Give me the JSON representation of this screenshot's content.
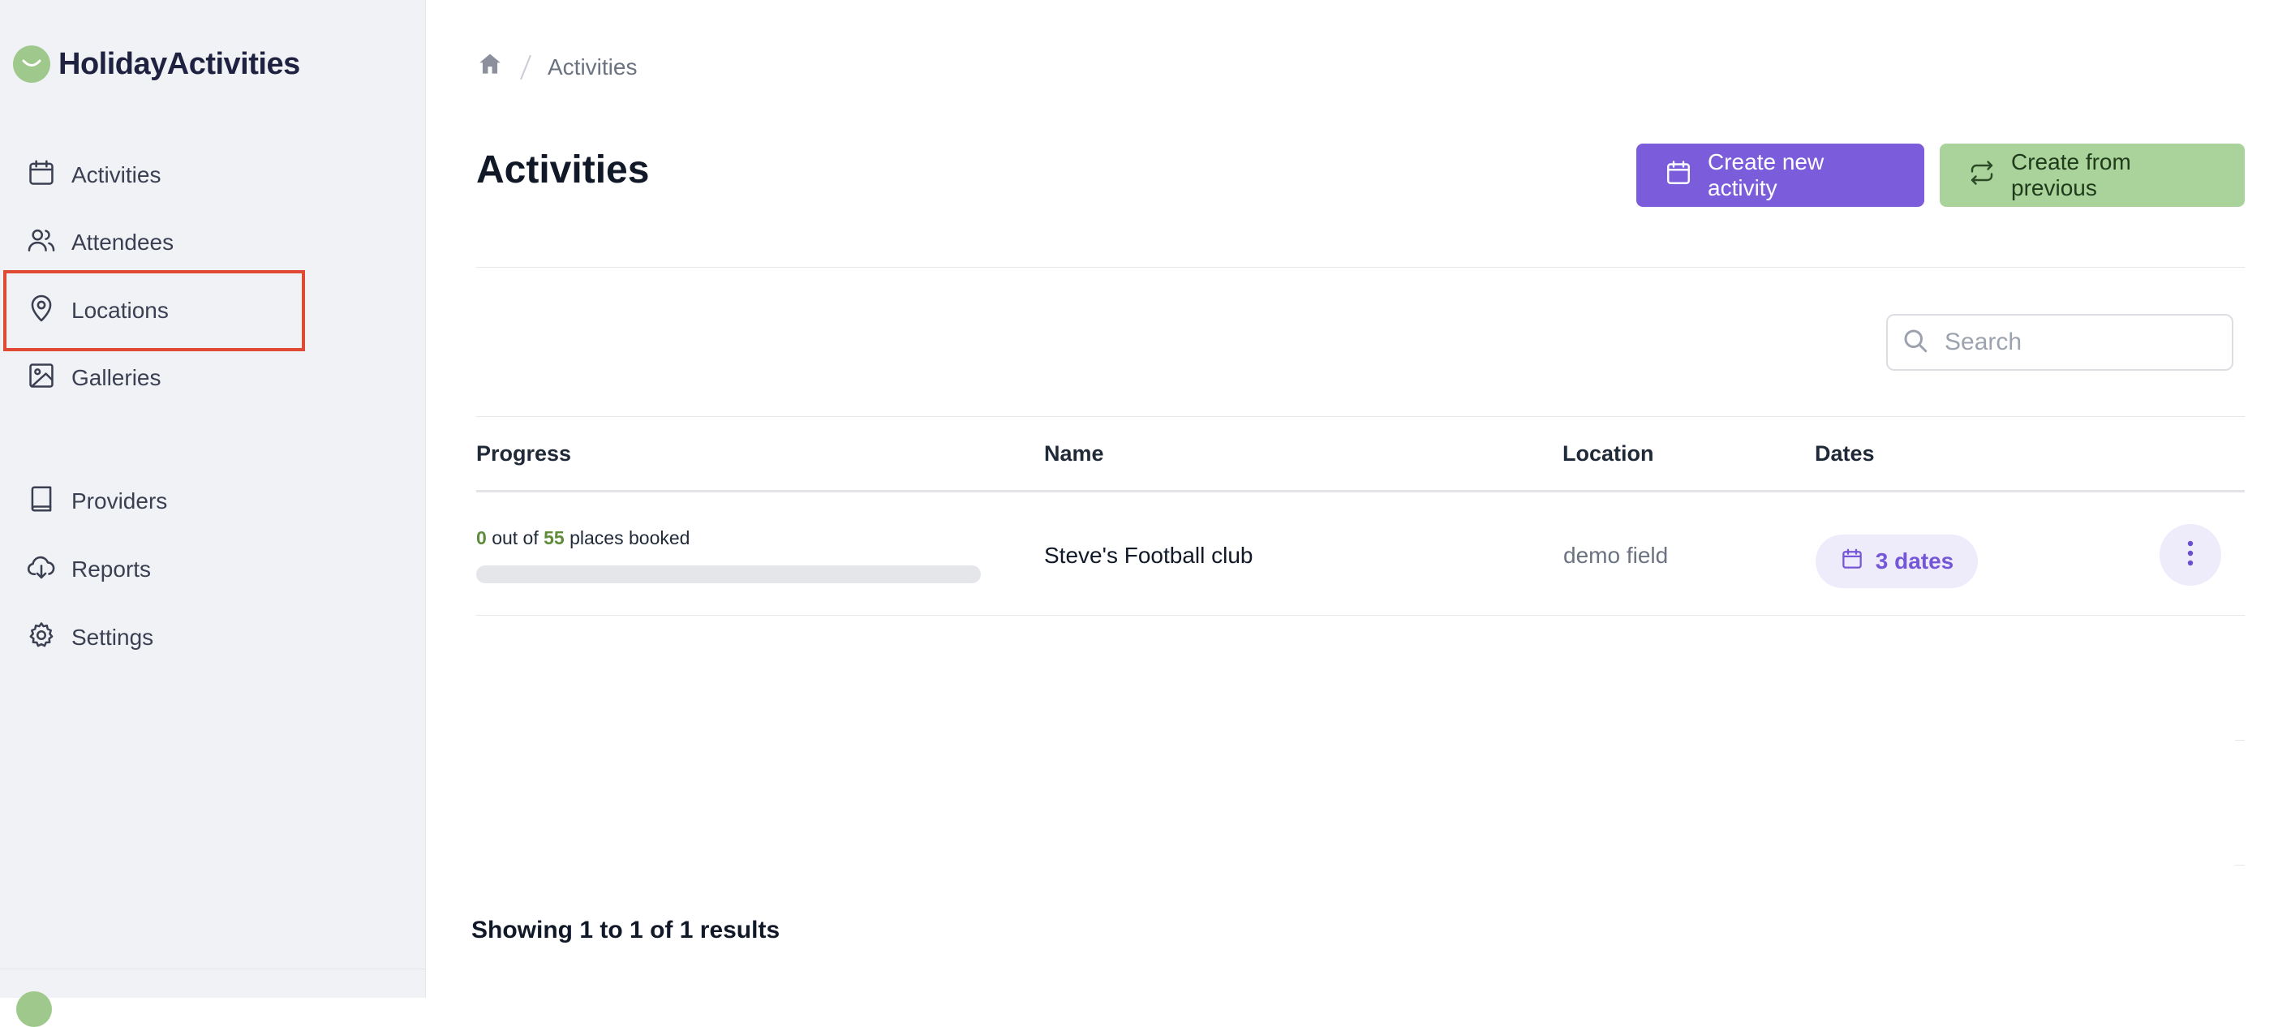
{
  "brand": {
    "name": "HolidayActivities",
    "logo_color": "#9fc98c"
  },
  "sidebar": {
    "items": [
      {
        "label": "Activities",
        "icon": "calendar-icon"
      },
      {
        "label": "Attendees",
        "icon": "users-icon"
      },
      {
        "label": "Locations",
        "icon": "map-pin-icon"
      },
      {
        "label": "Galleries",
        "icon": "image-icon"
      },
      {
        "label": "Providers",
        "icon": "book-icon"
      },
      {
        "label": "Reports",
        "icon": "cloud-download-icon"
      },
      {
        "label": "Settings",
        "icon": "gear-icon"
      }
    ],
    "highlighted_item": "Locations",
    "highlight_color": "#e04a35"
  },
  "breadcrumb": {
    "home_icon": "home-icon",
    "current": "Activities"
  },
  "page": {
    "title": "Activities"
  },
  "actions": {
    "create_new_label": "Create new activity",
    "create_from_previous_label": "Create from previous",
    "primary_color": "#7b5ddb",
    "secondary_color": "#a9d39a"
  },
  "search": {
    "placeholder": "Search",
    "value": ""
  },
  "table": {
    "columns": [
      "Progress",
      "Name",
      "Location",
      "Dates"
    ],
    "rows": [
      {
        "booked": "0",
        "capacity": "55",
        "progress_out_of": "out of",
        "progress_suffix": "places booked",
        "progress_fraction": 0,
        "name": "Steve's Football club",
        "location": "demo field",
        "dates_label": "3 dates"
      }
    ]
  },
  "pagination": {
    "prefix": "Showing",
    "from": "1",
    "to_word": "to",
    "to": "1",
    "of_word": "of",
    "total": "1",
    "suffix": "results"
  }
}
